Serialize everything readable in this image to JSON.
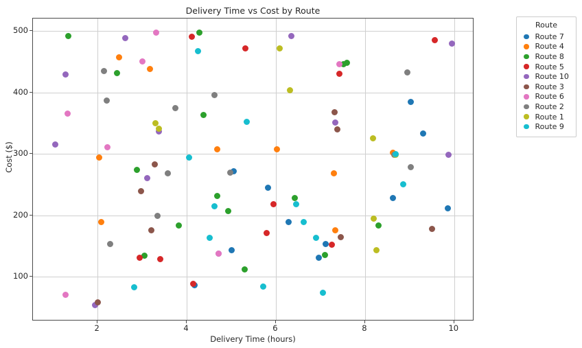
{
  "chart_data": {
    "type": "scatter",
    "title": "Delivery Time vs Cost by Route",
    "xlabel": "Delivery Time (hours)",
    "ylabel": "Cost ($)",
    "xlim": [
      0.55,
      10.45
    ],
    "ylim": [
      28,
      520
    ],
    "xticks": [
      2,
      4,
      6,
      8,
      10
    ],
    "yticks": [
      100,
      200,
      300,
      400,
      500
    ],
    "grid": true,
    "legend_title": "Route",
    "legend_position": "right-outside",
    "marker": "circle",
    "series": [
      {
        "name": "Route 7",
        "color": "#1f77b4",
        "points": [
          [
            4.18,
            87
          ],
          [
            5.05,
            272
          ],
          [
            5.0,
            144
          ],
          [
            5.82,
            245
          ],
          [
            6.28,
            189
          ],
          [
            6.97,
            131
          ],
          [
            7.12,
            153
          ],
          [
            8.63,
            228
          ],
          [
            9.03,
            385
          ],
          [
            9.3,
            333
          ],
          [
            9.85,
            211
          ]
        ]
      },
      {
        "name": "Route 4",
        "color": "#ff7f0e",
        "points": [
          [
            2.03,
            294
          ],
          [
            2.08,
            189
          ],
          [
            2.48,
            457
          ],
          [
            3.18,
            438
          ],
          [
            4.68,
            307
          ],
          [
            6.03,
            307
          ],
          [
            7.3,
            268
          ],
          [
            7.33,
            176
          ],
          [
            8.62,
            302
          ]
        ]
      },
      {
        "name": "Route 8",
        "color": "#2ca02c",
        "points": [
          [
            1.35,
            491
          ],
          [
            2.43,
            431
          ],
          [
            2.88,
            274
          ],
          [
            3.05,
            135
          ],
          [
            3.82,
            184
          ],
          [
            4.28,
            497
          ],
          [
            4.38,
            363
          ],
          [
            4.68,
            232
          ],
          [
            4.93,
            207
          ],
          [
            5.3,
            112
          ],
          [
            6.42,
            228
          ],
          [
            7.52,
            446
          ],
          [
            7.6,
            448
          ],
          [
            7.1,
            136
          ],
          [
            8.3,
            184
          ]
        ]
      },
      {
        "name": "Route 5",
        "color": "#d62728",
        "points": [
          [
            2.95,
            131
          ],
          [
            3.4,
            129
          ],
          [
            4.12,
            490
          ],
          [
            4.15,
            89
          ],
          [
            5.32,
            471
          ],
          [
            5.8,
            171
          ],
          [
            5.95,
            218
          ],
          [
            7.25,
            152
          ],
          [
            7.42,
            430
          ],
          [
            9.57,
            485
          ]
        ]
      },
      {
        "name": "Route 10",
        "color": "#9467bd",
        "points": [
          [
            1.05,
            315
          ],
          [
            1.28,
            429
          ],
          [
            1.95,
            54
          ],
          [
            2.62,
            488
          ],
          [
            3.12,
            261
          ],
          [
            3.38,
            336
          ],
          [
            4.72,
            138
          ],
          [
            6.35,
            491
          ],
          [
            7.33,
            351
          ],
          [
            9.88,
            299
          ],
          [
            9.95,
            479
          ]
        ]
      },
      {
        "name": "Route 3",
        "color": "#8c564b",
        "points": [
          [
            2.0,
            59
          ],
          [
            2.98,
            239
          ],
          [
            3.2,
            176
          ],
          [
            3.28,
            283
          ],
          [
            7.32,
            368
          ],
          [
            7.38,
            340
          ],
          [
            7.45,
            165
          ],
          [
            9.5,
            178
          ]
        ]
      },
      {
        "name": "Route 6",
        "color": "#e377c2",
        "points": [
          [
            1.33,
            366
          ],
          [
            1.28,
            71
          ],
          [
            2.22,
            311
          ],
          [
            3.0,
            450
          ],
          [
            3.32,
            497
          ],
          [
            4.72,
            138
          ],
          [
            7.42,
            446
          ]
        ]
      },
      {
        "name": "Route 2",
        "color": "#7f7f7f",
        "points": [
          [
            2.15,
            435
          ],
          [
            2.2,
            387
          ],
          [
            2.28,
            154
          ],
          [
            3.35,
            199
          ],
          [
            3.58,
            268
          ],
          [
            3.75,
            374
          ],
          [
            4.62,
            396
          ],
          [
            4.98,
            270
          ],
          [
            8.65,
            299
          ],
          [
            8.95,
            432
          ],
          [
            9.02,
            279
          ]
        ]
      },
      {
        "name": "Route 1",
        "color": "#bcbd22",
        "points": [
          [
            3.3,
            350
          ],
          [
            3.38,
            341
          ],
          [
            6.32,
            403
          ],
          [
            6.08,
            472
          ],
          [
            8.18,
            325
          ],
          [
            8.2,
            195
          ],
          [
            8.25,
            144
          ],
          [
            8.68,
            298
          ]
        ]
      },
      {
        "name": "Route 9",
        "color": "#17becf",
        "points": [
          [
            2.82,
            83
          ],
          [
            4.05,
            294
          ],
          [
            4.25,
            467
          ],
          [
            4.52,
            164
          ],
          [
            4.62,
            215
          ],
          [
            5.35,
            352
          ],
          [
            5.72,
            84
          ],
          [
            6.45,
            218
          ],
          [
            6.62,
            189
          ],
          [
            6.9,
            163
          ],
          [
            7.05,
            74
          ],
          [
            8.68,
            300
          ],
          [
            8.85,
            251
          ]
        ]
      }
    ]
  }
}
